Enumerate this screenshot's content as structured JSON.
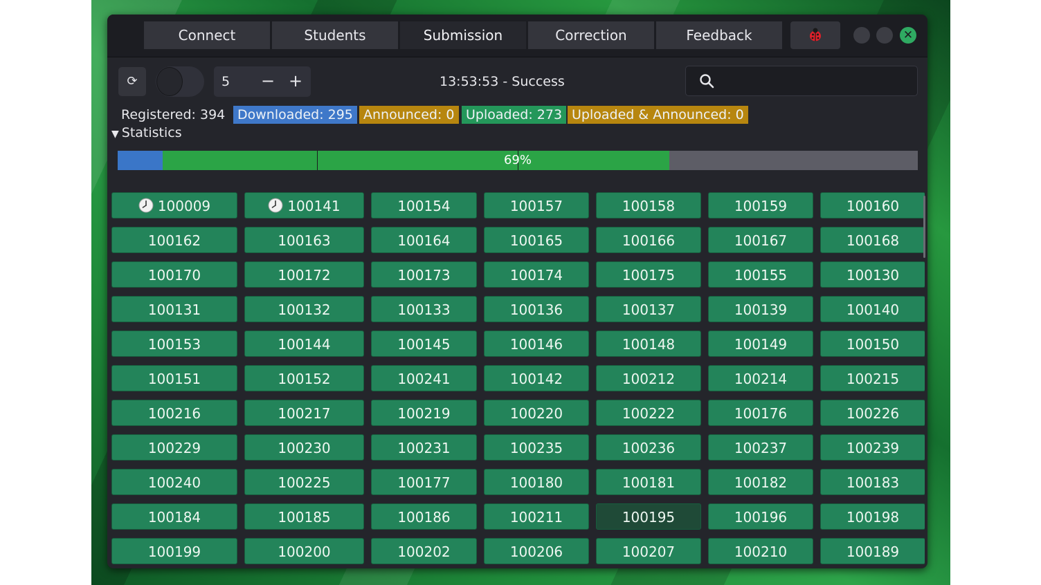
{
  "tabs": [
    {
      "label": "Connect"
    },
    {
      "label": "Students"
    },
    {
      "label": "Submission"
    },
    {
      "label": "Correction"
    },
    {
      "label": "Feedback"
    }
  ],
  "active_tab": "Submission",
  "bug_icon": "ladybug-icon",
  "toolbar": {
    "refresh_icon": "refresh-icon",
    "spin_value": "5",
    "spin_minus": "−",
    "spin_plus": "+",
    "status": "13:53:53 - Success",
    "search_placeholder": ""
  },
  "stats": {
    "registered": "Registered: 394",
    "downloaded": "Downloaded: 295",
    "announced": "Announced: 0",
    "uploaded": "Uploaded: 273",
    "uploaded_announced": "Uploaded & Announced: 0"
  },
  "colors": {
    "downloaded": "#3f78c9",
    "announced": "#b7860f",
    "uploaded": "#24975a",
    "uploaded_announced": "#b7860f",
    "progress_blue": "#3a76c8",
    "progress_green": "#2ba446",
    "progress_track": "#5d5d66",
    "student_button": "#23845a"
  },
  "statistics_label": "Statistics",
  "progress": {
    "label": "69%",
    "blue_fraction": 0.056,
    "green_fraction": 0.6335,
    "divider_fractions": [
      0.249,
      0.5
    ]
  },
  "students": [
    {
      "id": "100009",
      "clock": true
    },
    {
      "id": "100141",
      "clock": true
    },
    {
      "id": "100154"
    },
    {
      "id": "100157"
    },
    {
      "id": "100158"
    },
    {
      "id": "100159"
    },
    {
      "id": "100160"
    },
    {
      "id": "100162"
    },
    {
      "id": "100163"
    },
    {
      "id": "100164"
    },
    {
      "id": "100165"
    },
    {
      "id": "100166"
    },
    {
      "id": "100167"
    },
    {
      "id": "100168"
    },
    {
      "id": "100170"
    },
    {
      "id": "100172"
    },
    {
      "id": "100173"
    },
    {
      "id": "100174"
    },
    {
      "id": "100175"
    },
    {
      "id": "100155"
    },
    {
      "id": "100130"
    },
    {
      "id": "100131"
    },
    {
      "id": "100132"
    },
    {
      "id": "100133"
    },
    {
      "id": "100136"
    },
    {
      "id": "100137"
    },
    {
      "id": "100139"
    },
    {
      "id": "100140"
    },
    {
      "id": "100153"
    },
    {
      "id": "100144"
    },
    {
      "id": "100145"
    },
    {
      "id": "100146"
    },
    {
      "id": "100148"
    },
    {
      "id": "100149"
    },
    {
      "id": "100150"
    },
    {
      "id": "100151"
    },
    {
      "id": "100152"
    },
    {
      "id": "100241"
    },
    {
      "id": "100142"
    },
    {
      "id": "100212"
    },
    {
      "id": "100214"
    },
    {
      "id": "100215"
    },
    {
      "id": "100216"
    },
    {
      "id": "100217"
    },
    {
      "id": "100219"
    },
    {
      "id": "100220"
    },
    {
      "id": "100222"
    },
    {
      "id": "100176"
    },
    {
      "id": "100226"
    },
    {
      "id": "100229"
    },
    {
      "id": "100230"
    },
    {
      "id": "100231"
    },
    {
      "id": "100235"
    },
    {
      "id": "100236"
    },
    {
      "id": "100237"
    },
    {
      "id": "100239"
    },
    {
      "id": "100240"
    },
    {
      "id": "100225"
    },
    {
      "id": "100177"
    },
    {
      "id": "100180"
    },
    {
      "id": "100181"
    },
    {
      "id": "100182"
    },
    {
      "id": "100183"
    },
    {
      "id": "100184"
    },
    {
      "id": "100185"
    },
    {
      "id": "100186"
    },
    {
      "id": "100211"
    },
    {
      "id": "100195",
      "dim": true
    },
    {
      "id": "100196"
    },
    {
      "id": "100198"
    },
    {
      "id": "100199"
    },
    {
      "id": "100200"
    },
    {
      "id": "100202"
    },
    {
      "id": "100206"
    },
    {
      "id": "100207"
    },
    {
      "id": "100210"
    },
    {
      "id": "100189"
    }
  ]
}
